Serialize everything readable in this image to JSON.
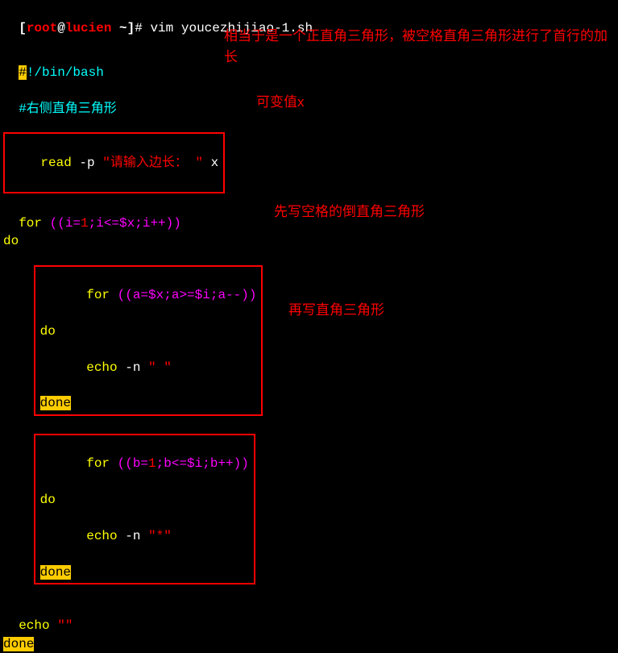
{
  "prompt": {
    "bracket_open": "[",
    "user": "root",
    "at": "@",
    "host": "lucien",
    "tilde": " ~",
    "bracket_close": "]",
    "hash": "# ",
    "command": "vim youcezhijiao-1.sh"
  },
  "code": {
    "shebang_hash": "#",
    "shebang_bang": "!/bin/bash",
    "comment": "#右侧直角三角形",
    "read_line": {
      "read": "read",
      "flag": " -p ",
      "string": "\"请输入边长： \"",
      "var": " x"
    },
    "for1": {
      "for": "for ",
      "paren": "((i=",
      "one": "1",
      "mid": ";i<=$x;i++))"
    },
    "do": "do",
    "for2": {
      "for": "for ",
      "paren": "((a=$x;a>=$i;a--))"
    },
    "echo1": {
      "echo": "echo",
      "flag": " -n ",
      "str": "\" \""
    },
    "done": "done",
    "for3": {
      "for": "for ",
      "paren": "((b=",
      "one": "1",
      "mid": ";b<=$i;b++))"
    },
    "echo2": {
      "echo": "echo",
      "flag": " -n ",
      "str": "\"*\""
    },
    "echo3": {
      "echo": "echo ",
      "str": "\"\""
    }
  },
  "annotations": {
    "a1": "相当于是一个正直角三角形，被空格直角三角形进行了首行的加长",
    "a2": "可变值x",
    "a3": "先写空格的倒直角三角形",
    "a4": "再写直角三角形"
  }
}
